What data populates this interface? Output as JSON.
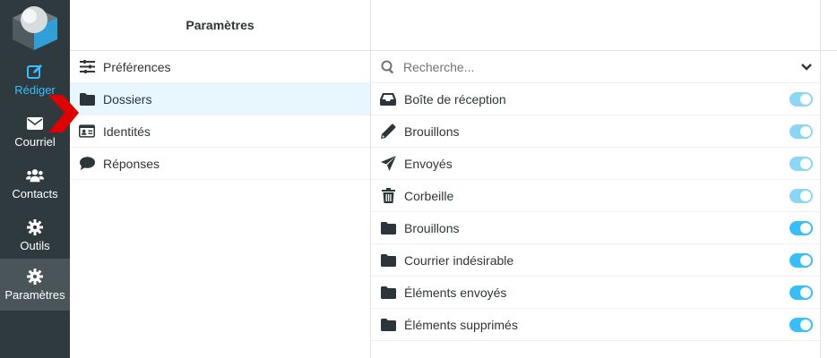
{
  "nav": {
    "items": [
      {
        "label": "Rédiger",
        "icon": "compose-icon"
      },
      {
        "label": "Courriel",
        "icon": "envelope-icon"
      },
      {
        "label": "Contacts",
        "icon": "users-icon"
      },
      {
        "label": "Outils",
        "icon": "gear-icon"
      },
      {
        "label": "Paramètres",
        "icon": "gear-icon"
      }
    ]
  },
  "settings": {
    "title": "Paramètres",
    "items": [
      {
        "label": "Préférences",
        "icon": "sliders-icon"
      },
      {
        "label": "Dossiers",
        "icon": "folder-icon"
      },
      {
        "label": "Identités",
        "icon": "id-card-icon"
      },
      {
        "label": "Réponses",
        "icon": "comment-icon"
      }
    ]
  },
  "folders": {
    "search_placeholder": "Recherche...",
    "items": [
      {
        "label": "Boîte de réception",
        "icon": "inbox-icon",
        "subscribed": true,
        "locked": true
      },
      {
        "label": "Brouillons",
        "icon": "pencil-icon",
        "subscribed": true,
        "locked": true
      },
      {
        "label": "Envoyés",
        "icon": "paper-plane-icon",
        "subscribed": true,
        "locked": true
      },
      {
        "label": "Corbeille",
        "icon": "trash-icon",
        "subscribed": true,
        "locked": true
      },
      {
        "label": "Brouillons",
        "icon": "folder-icon",
        "subscribed": true,
        "locked": false
      },
      {
        "label": "Courrier indésirable",
        "icon": "folder-icon",
        "subscribed": true,
        "locked": false
      },
      {
        "label": "Éléments envoyés",
        "icon": "folder-icon",
        "subscribed": true,
        "locked": false
      },
      {
        "label": "Éléments supprimés",
        "icon": "folder-icon",
        "subscribed": true,
        "locked": false
      }
    ]
  },
  "colors": {
    "accent": "#37beff",
    "toggle_on": "#37beff",
    "toggle_locked": "#8ad6f7",
    "nav_bg": "#2f3a3f",
    "nav_selected": "#4a5559",
    "annotation": "#e00000"
  }
}
